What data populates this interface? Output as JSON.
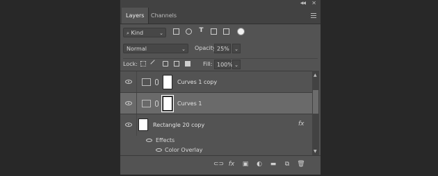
{
  "panel": {
    "tabs": [
      {
        "label": "Layers"
      },
      {
        "label": "Channels"
      }
    ]
  },
  "filter": {
    "kind_label": "Kind"
  },
  "blend": {
    "mode": "Normal",
    "opacity_label": "Opacity:",
    "opacity_value": "25%"
  },
  "lock": {
    "label": "Lock:",
    "fill_label": "Fill:",
    "fill_value": "100%"
  },
  "layers": [
    {
      "name": "Curves 1 copy"
    },
    {
      "name": "Curves 1"
    },
    {
      "name": "Rectangle 20 copy",
      "fx": "fx"
    }
  ],
  "effects": {
    "label": "Effects",
    "items": [
      {
        "label": "Color Overlay"
      }
    ]
  },
  "icons": {
    "fx_bottom": "fx"
  }
}
